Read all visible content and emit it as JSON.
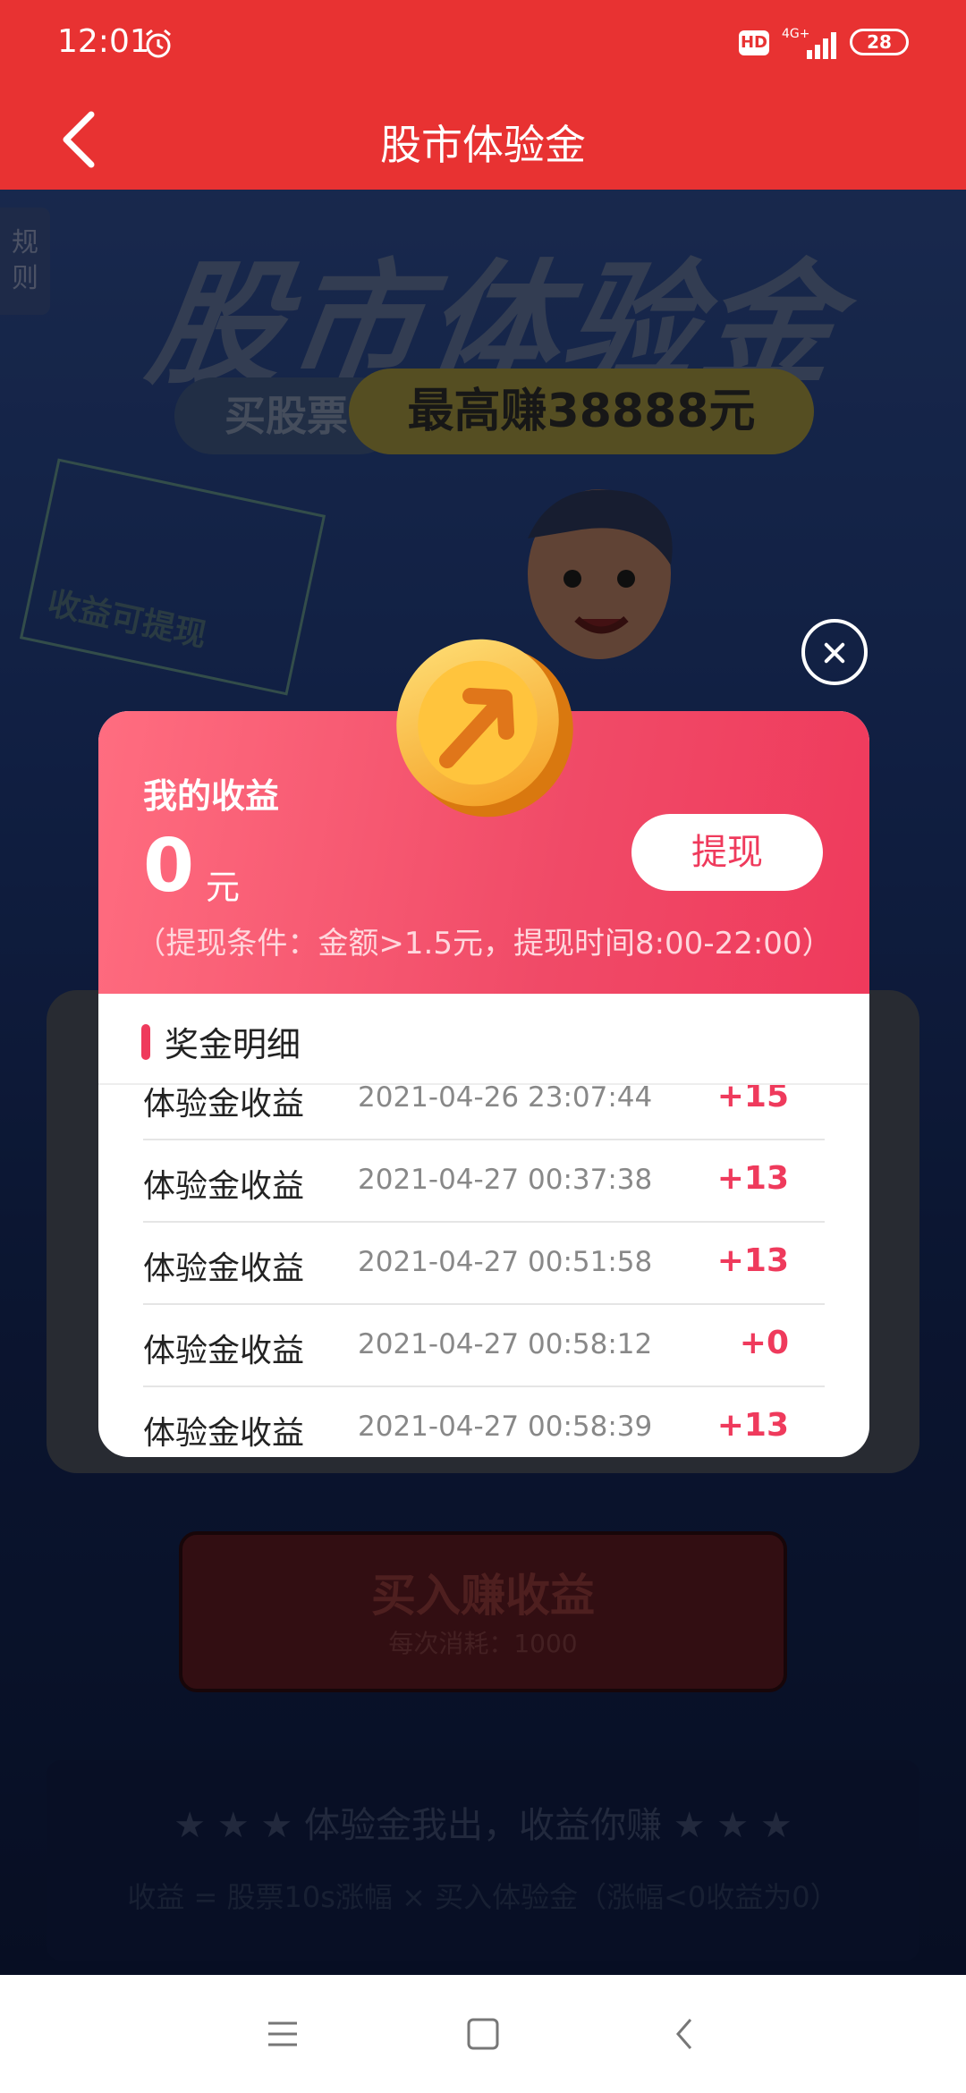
{
  "status_bar": {
    "time": "12:01",
    "hd": "HD",
    "network": "4G+",
    "battery": "28"
  },
  "nav": {
    "title": "股市体验金"
  },
  "hero": {
    "rules_label": "规则",
    "big_title": "股市体验金",
    "pill_left": "买股票",
    "pill_right": "最高赚38888元",
    "badge_text": "收益可提现"
  },
  "modal": {
    "earnings_label": "我的收益",
    "earnings_amount": "0",
    "earnings_unit": "元",
    "withdraw_button": "提现",
    "withdraw_condition": "（提现条件：金额>1.5元，提现时间8:00-22:00）",
    "section_title": "奖金明细",
    "rows": [
      {
        "name": "体验金收益",
        "time": "2021-04-26 23:07:44",
        "value": "+15"
      },
      {
        "name": "体验金收益",
        "time": "2021-04-27 00:37:38",
        "value": "+13"
      },
      {
        "name": "体验金收益",
        "time": "2021-04-27 00:51:58",
        "value": "+13"
      },
      {
        "name": "体验金收益",
        "time": "2021-04-27 00:58:12",
        "value": "+0"
      },
      {
        "name": "体验金收益",
        "time": "2021-04-27 00:58:39",
        "value": "+13"
      }
    ]
  },
  "buy": {
    "label": "买入赚收益",
    "cost": "每次消耗：1000"
  },
  "bottom": {
    "slogan": "体验金我出，收益你赚",
    "formula": "收益 = 股票10s涨幅 × 买入体验金（涨幅<0收益为0）"
  },
  "colors": {
    "primary_red": "#e83232",
    "accent_pink": "#ef3a5c"
  }
}
